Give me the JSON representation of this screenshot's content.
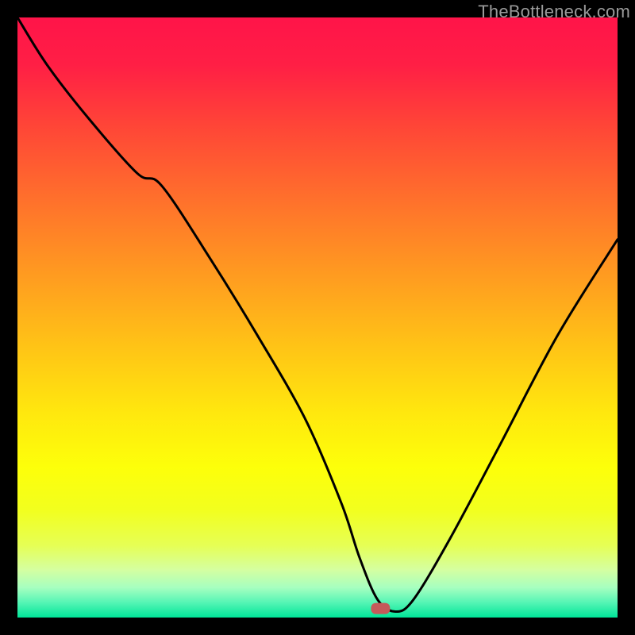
{
  "watermark": "TheBottleneck.com",
  "gradient": {
    "stops": [
      {
        "offset": 0.0,
        "color": "#ff1449"
      },
      {
        "offset": 0.08,
        "color": "#ff1f45"
      },
      {
        "offset": 0.18,
        "color": "#ff4537"
      },
      {
        "offset": 0.3,
        "color": "#ff6f2c"
      },
      {
        "offset": 0.42,
        "color": "#ff9821"
      },
      {
        "offset": 0.55,
        "color": "#ffc416"
      },
      {
        "offset": 0.66,
        "color": "#ffe80e"
      },
      {
        "offset": 0.75,
        "color": "#fdff0a"
      },
      {
        "offset": 0.82,
        "color": "#f2ff1e"
      },
      {
        "offset": 0.88,
        "color": "#e6ff55"
      },
      {
        "offset": 0.92,
        "color": "#d5ffa0"
      },
      {
        "offset": 0.95,
        "color": "#a7ffc0"
      },
      {
        "offset": 0.975,
        "color": "#55f5b5"
      },
      {
        "offset": 1.0,
        "color": "#00e598"
      }
    ]
  },
  "marker": {
    "x_pct": 0.605,
    "y_pct": 0.985,
    "color": "#c55a5a"
  },
  "chart_data": {
    "type": "line",
    "title": "",
    "xlabel": "",
    "ylabel": "",
    "xlim": [
      0,
      100
    ],
    "ylim": [
      0,
      100
    ],
    "grid": false,
    "legend": false,
    "series": [
      {
        "name": "bottleneck-curve",
        "x": [
          0,
          5,
          12,
          20,
          24,
          32,
          40,
          48,
          54,
          57,
          60,
          63,
          66,
          72,
          80,
          90,
          100
        ],
        "y": [
          100,
          92,
          83,
          74,
          72,
          60,
          47,
          33,
          19,
          10,
          3,
          1,
          3,
          13,
          28,
          47,
          63
        ]
      }
    ],
    "annotations": [
      {
        "type": "marker",
        "x": 60.5,
        "y": 1.5,
        "label": "optimal-point"
      }
    ]
  }
}
